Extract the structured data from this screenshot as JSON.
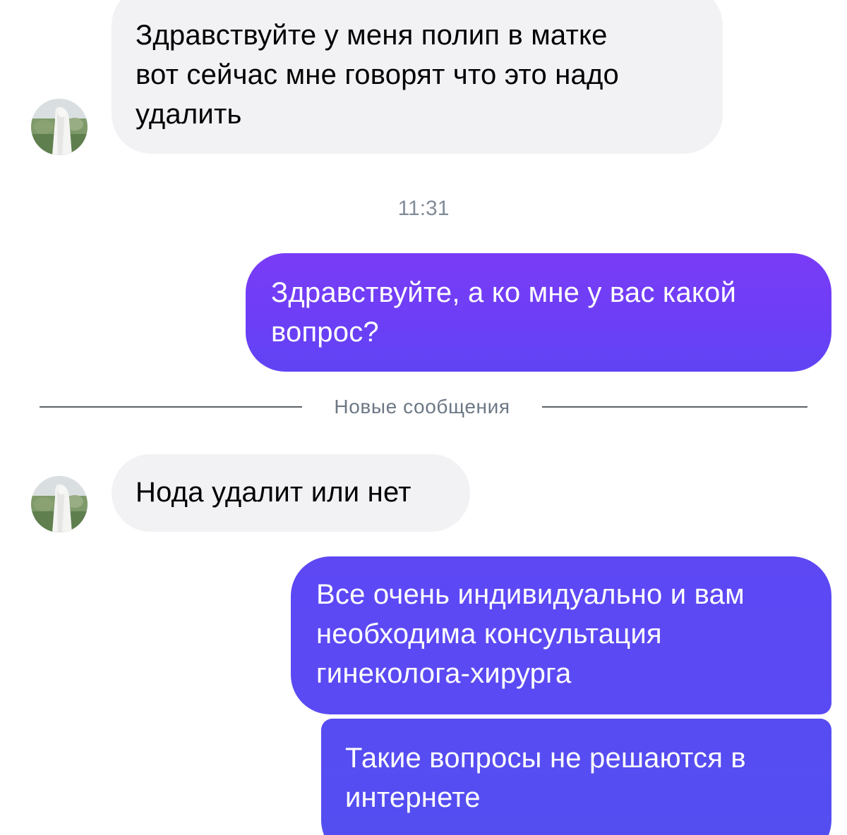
{
  "messages": [
    {
      "id": "msg1",
      "direction": "incoming",
      "lines": [
        "Здравствуйте у меня полип в матке",
        "вот сейчас мне говорят что это надо",
        "удалить"
      ]
    },
    {
      "id": "msg2",
      "direction": "outgoing",
      "lines": [
        "Здравствуйте, а ко мне у вас какой",
        "вопрос?"
      ]
    },
    {
      "id": "msg3",
      "direction": "incoming",
      "lines": [
        "Нода удалит или нет"
      ]
    },
    {
      "id": "msg4",
      "direction": "outgoing",
      "lines": [
        "Все очень индивидуально и вам",
        "необходима консультация",
        "гинеколога-хирурга"
      ]
    },
    {
      "id": "msg5",
      "direction": "outgoing",
      "lines": [
        "Такие вопросы не решаются в",
        "интернете"
      ]
    }
  ],
  "timestamp": "11:31",
  "new_messages_divider": "Новые сообщения",
  "colors": {
    "incoming_bubble": "#f2f2f5",
    "outgoing_bubble_start": "#7a3cf6",
    "outgoing_bubble_end": "#534ef1",
    "meta_text": "#818c99"
  },
  "icons": {
    "avatar": "user-avatar-photo"
  }
}
